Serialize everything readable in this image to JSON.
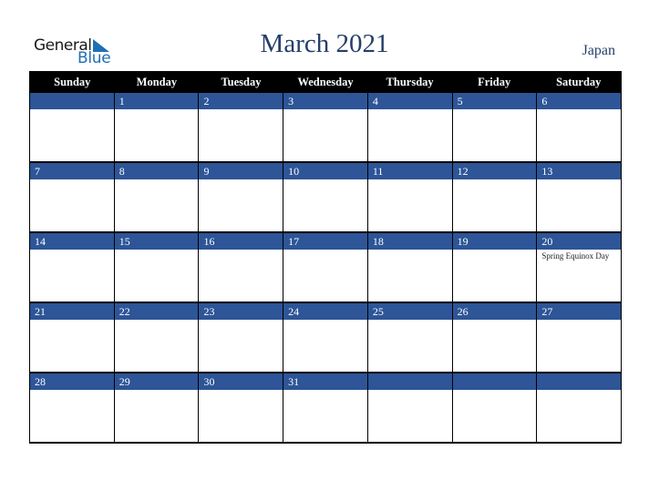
{
  "logo": {
    "word1": "General",
    "word2": "Blue"
  },
  "header": {
    "title": "March 2021",
    "country": "Japan"
  },
  "colors": {
    "date_strip": "#2d5597",
    "title": "#243f6b",
    "brand": "#1f6fb5"
  },
  "weekdays": [
    "Sunday",
    "Monday",
    "Tuesday",
    "Wednesday",
    "Thursday",
    "Friday",
    "Saturday"
  ],
  "weeks": [
    {
      "dates": [
        "",
        "1",
        "2",
        "3",
        "4",
        "5",
        "6"
      ],
      "events": [
        "",
        "",
        "",
        "",
        "",
        "",
        ""
      ]
    },
    {
      "dates": [
        "7",
        "8",
        "9",
        "10",
        "11",
        "12",
        "13"
      ],
      "events": [
        "",
        "",
        "",
        "",
        "",
        "",
        ""
      ]
    },
    {
      "dates": [
        "14",
        "15",
        "16",
        "17",
        "18",
        "19",
        "20"
      ],
      "events": [
        "",
        "",
        "",
        "",
        "",
        "",
        "Spring Equinox Day"
      ]
    },
    {
      "dates": [
        "21",
        "22",
        "23",
        "24",
        "25",
        "26",
        "27"
      ],
      "events": [
        "",
        "",
        "",
        "",
        "",
        "",
        ""
      ]
    },
    {
      "dates": [
        "28",
        "29",
        "30",
        "31",
        "",
        "",
        ""
      ],
      "events": [
        "",
        "",
        "",
        "",
        "",
        "",
        ""
      ]
    }
  ]
}
